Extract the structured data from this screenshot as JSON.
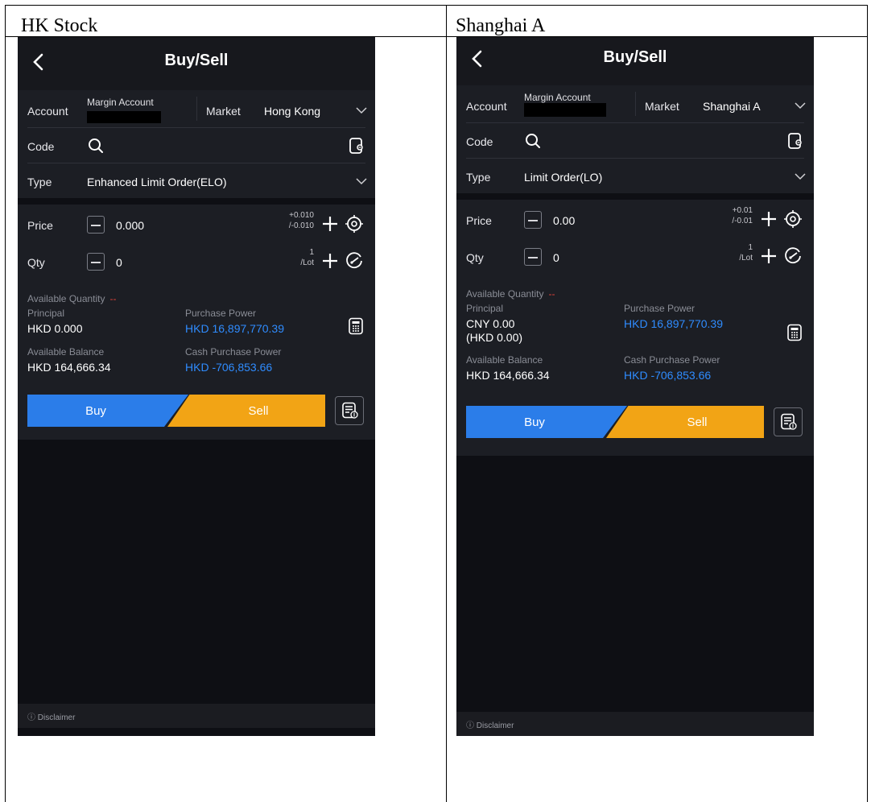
{
  "columns": [
    {
      "heading": "HK Stock",
      "nav_title": "Buy/Sell",
      "account_label": "Account",
      "account_value": "Margin Account",
      "market_label": "Market",
      "market_value": "Hong Kong",
      "code_label": "Code",
      "type_label": "Type",
      "type_value": "Enhanced Limit Order(ELO)",
      "price_label": "Price",
      "price_value": "0.000",
      "price_step_up": "+0.010",
      "price_step_down": "/-0.010",
      "qty_label": "Qty",
      "qty_value": "0",
      "qty_step_top": "1",
      "qty_step_bottom": "/Lot",
      "available_qty_label": "Available Quantity",
      "available_qty_value": "--",
      "principal_label": "Principal",
      "principal_value": "HKD 0.000",
      "principal_sub": "",
      "purchase_power_label": "Purchase Power",
      "purchase_power_value": "HKD 16,897,770.39",
      "available_balance_label": "Available Balance",
      "available_balance_value": "HKD 164,666.34",
      "cash_purchase_power_label": "Cash Purchase Power",
      "cash_purchase_power_value": "HKD -706,853.66",
      "buy_label": "Buy",
      "sell_label": "Sell",
      "disclaimer": "Disclaimer"
    },
    {
      "heading": "Shanghai A",
      "nav_title": "Buy/Sell",
      "account_label": "Account",
      "account_value": "Margin Account",
      "market_label": "Market",
      "market_value": "Shanghai A",
      "code_label": "Code",
      "type_label": "Type",
      "type_value": "Limit Order(LO)",
      "price_label": "Price",
      "price_value": "0.00",
      "price_step_up": "+0.01",
      "price_step_down": "/-0.01",
      "qty_label": "Qty",
      "qty_value": "0",
      "qty_step_top": "1",
      "qty_step_bottom": "/Lot",
      "available_qty_label": "Available Quantity",
      "available_qty_value": "--",
      "principal_label": "Principal",
      "principal_value": "CNY 0.00",
      "principal_sub": "(HKD 0.00)",
      "purchase_power_label": "Purchase Power",
      "purchase_power_value": "HKD 16,897,770.39",
      "available_balance_label": "Available Balance",
      "available_balance_value": "HKD 164,666.34",
      "cash_purchase_power_label": "Cash Purchase Power",
      "cash_purchase_power_value": "HKD -706,853.66",
      "buy_label": "Buy",
      "sell_label": "Sell",
      "disclaimer": "Disclaimer"
    }
  ],
  "colors": {
    "buy": "#2b7de9",
    "sell": "#f2a415",
    "accent_value": "#2f8cff",
    "dash": "#e0413a",
    "background": "#0e0f14"
  },
  "icons": [
    "back-chevron-icon",
    "search-icon",
    "wallet-icon",
    "chevron-down-icon",
    "minus-icon",
    "plus-icon",
    "target-icon",
    "gauge-icon",
    "calculator-icon",
    "order-list-icon",
    "info-circle-icon"
  ]
}
